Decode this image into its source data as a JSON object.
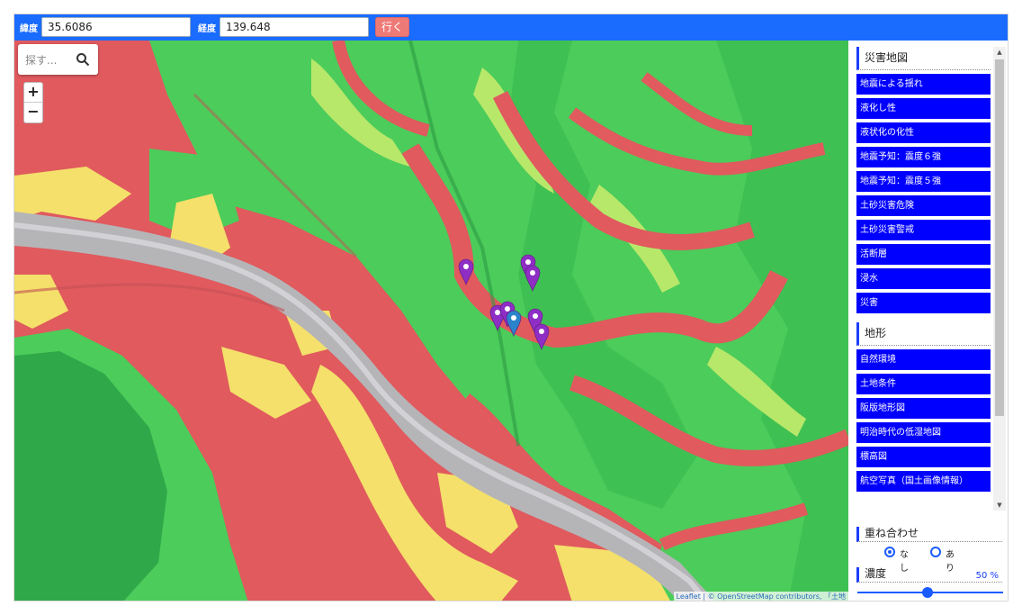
{
  "topbar": {
    "lat_label": "緯度",
    "lat_value": "35.6086",
    "lng_label": "経度",
    "lng_value": "139.648",
    "go_label": "行く"
  },
  "search": {
    "placeholder": "探す..."
  },
  "zoom": {
    "in_label": "+",
    "out_label": "−"
  },
  "attribution": "Leaflet | © OpenStreetMap contributors, 「土地",
  "panel": {
    "sections": [
      {
        "title": "災害地図",
        "items": [
          "地震による揺れ",
          "液化し性",
          "液状化の化性",
          "地震予知：震度６強",
          "地震予知：震度５強",
          "土砂災害危険",
          "土砂災害警戒",
          "活断層",
          "浸水",
          "災害"
        ]
      },
      {
        "title": "地形",
        "items": [
          "自然環境",
          "土地条件",
          "阪版地形図",
          "明治時代の低湿地図",
          "標高図",
          "航空写真（国土画像情報）"
        ]
      }
    ],
    "overlay": {
      "title": "重ね合わせ",
      "options": [
        {
          "label": "なし",
          "selected": true
        },
        {
          "label": "あり",
          "selected": false
        }
      ]
    },
    "density": {
      "title": "濃度",
      "value": 50,
      "value_label": "50 %"
    }
  },
  "map": {
    "markers": [
      {
        "color": "#8e2ec4",
        "label": "marker-1"
      },
      {
        "color": "#8e2ec4",
        "label": "marker-2"
      },
      {
        "color": "#8e2ec4",
        "label": "marker-3"
      },
      {
        "color": "#8e2ec4",
        "label": "marker-4"
      },
      {
        "color": "#8e2ec4",
        "label": "marker-5"
      },
      {
        "color": "#8e2ec4",
        "label": "marker-6"
      },
      {
        "color": "#8e2ec4",
        "label": "marker-7"
      },
      {
        "color": "#2b83cb",
        "label": "marker-8"
      }
    ],
    "hazard_colors": {
      "high": "#e05a5e",
      "medium": "#f4e06a",
      "low": "#4ccc5a",
      "lowest": "#2fa84a",
      "river": "#b5b5b8"
    }
  }
}
